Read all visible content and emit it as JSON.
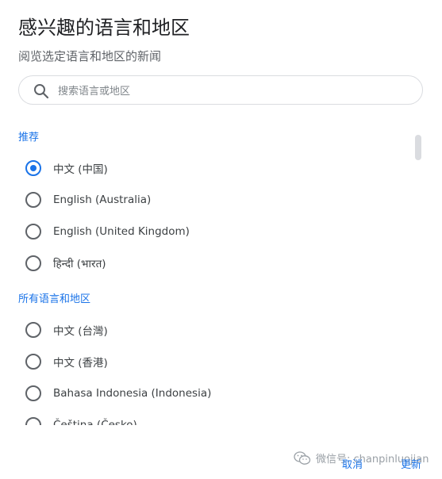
{
  "dialog": {
    "title": "感兴趣的语言和地区",
    "subtitle": "阅览选定语言和地区的新闻"
  },
  "search": {
    "placeholder": "搜索语言或地区",
    "value": ""
  },
  "sections": {
    "recommended_label": "推荐",
    "all_label": "所有语言和地区"
  },
  "recommended": [
    {
      "label": "中文 (中国)",
      "selected": true
    },
    {
      "label": "English (Australia)",
      "selected": false
    },
    {
      "label": "English (United Kingdom)",
      "selected": false
    },
    {
      "label": "हिन्दी (भारत)",
      "selected": false
    }
  ],
  "all": [
    {
      "label": "中文 (台灣)",
      "selected": false
    },
    {
      "label": "中文 (香港)",
      "selected": false
    },
    {
      "label": "Bahasa Indonesia (Indonesia)",
      "selected": false
    },
    {
      "label": "Čeština (Česko)",
      "selected": false
    }
  ],
  "actions": {
    "cancel": "取消",
    "update": "更新"
  },
  "watermark": "微信号: chanpinluojian",
  "colors": {
    "accent": "#1a73e8",
    "text": "#202124",
    "secondary": "#5f6368"
  }
}
